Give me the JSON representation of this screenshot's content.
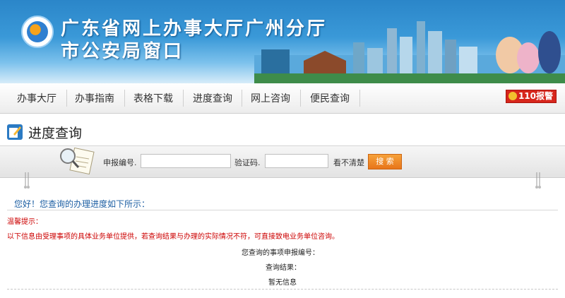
{
  "banner": {
    "title_line1": "广东省网上办事大厅广州分厅",
    "title_line2": "市公安局窗口"
  },
  "nav": {
    "items": [
      {
        "label": "办事大厅"
      },
      {
        "label": "办事指南"
      },
      {
        "label": "表格下载"
      },
      {
        "label": "进度查询"
      },
      {
        "label": "网上咨询"
      },
      {
        "label": "便民查询"
      }
    ],
    "emergency_label": "110报警"
  },
  "page": {
    "title": "进度查询"
  },
  "search": {
    "apply_no_label": "申报编号.",
    "apply_no_value": "",
    "captcha_label": "验证码.",
    "captcha_value": "",
    "refresh_label": "看不清楚",
    "submit_label": "搜 索"
  },
  "result": {
    "greeting": "您好！您查询的办理进度如下所示：",
    "tip_title": "温馨提示：",
    "tip_text": "以下信息由受理事项的具体业务单位提供，若查询结果与办理的实际情况不符，可直接致电业务单位咨询。",
    "apply_no_label": "您查询的事项申报编号：",
    "query_result_label": "查询结果：",
    "query_result_value": "暂无信息"
  },
  "colors": {
    "banner_blue": "#2b86c9",
    "link_blue": "#1d5fa3",
    "tip_red": "#cc0000",
    "search_orange": "#e8751a",
    "alarm_red": "#d7261c"
  }
}
